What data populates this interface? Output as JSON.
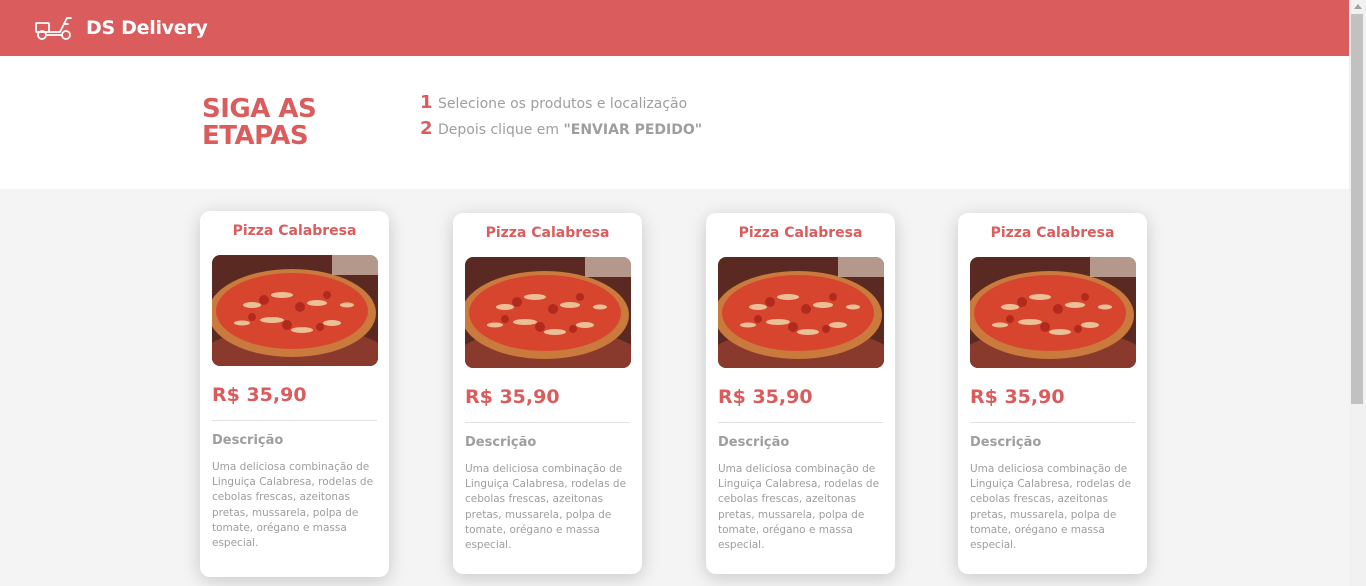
{
  "navbar": {
    "title": "DS Delivery",
    "logo_icon": "scooter-icon"
  },
  "steps": {
    "title": "SIGA AS ETAPAS",
    "items": [
      {
        "number": "1",
        "text": "Selecione os produtos e localização",
        "bold": ""
      },
      {
        "number": "2",
        "text": "Depois clique em ",
        "bold": "\"ENVIAR PEDIDO\""
      }
    ]
  },
  "products": [
    {
      "name": "Pizza Calabresa",
      "price": "R$ 35,90",
      "desc_label": "Descrição",
      "description": "Uma deliciosa combinação de Linguiça Calabresa, rodelas de cebolas frescas, azeitonas pretas, mussarela, polpa de tomate, orégano e massa especial."
    },
    {
      "name": "Pizza Calabresa",
      "price": "R$ 35,90",
      "desc_label": "Descrição",
      "description": "Uma deliciosa combinação de Linguiça Calabresa, rodelas de cebolas frescas, azeitonas pretas, mussarela, polpa de tomate, orégano e massa especial."
    },
    {
      "name": "Pizza Calabresa",
      "price": "R$ 35,90",
      "desc_label": "Descrição",
      "description": "Uma deliciosa combinação de Linguiça Calabresa, rodelas de cebolas frescas, azeitonas pretas, mussarela, polpa de tomate, orégano e massa especial."
    },
    {
      "name": "Pizza Calabresa",
      "price": "R$ 35,90",
      "desc_label": "Descrição",
      "description": "Uma deliciosa combinação de Linguiça Calabresa, rodelas de cebolas frescas, azeitonas pretas, mussarela, polpa de tomate, orégano e massa especial."
    }
  ],
  "colors": {
    "brand": "#da5c5c",
    "muted_text": "#9e9e9e",
    "background": "#f4f4f4"
  }
}
